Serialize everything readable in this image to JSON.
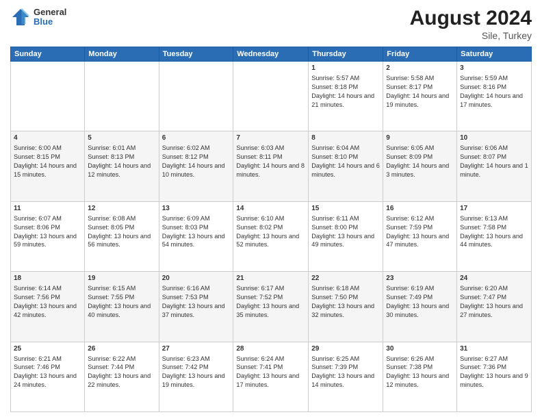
{
  "header": {
    "logo_general": "General",
    "logo_blue": "Blue",
    "month_year": "August 2024",
    "location": "Sile, Turkey"
  },
  "days_of_week": [
    "Sunday",
    "Monday",
    "Tuesday",
    "Wednesday",
    "Thursday",
    "Friday",
    "Saturday"
  ],
  "weeks": [
    [
      {
        "day": "",
        "content": ""
      },
      {
        "day": "",
        "content": ""
      },
      {
        "day": "",
        "content": ""
      },
      {
        "day": "",
        "content": ""
      },
      {
        "day": "1",
        "content": "Sunrise: 5:57 AM\nSunset: 8:18 PM\nDaylight: 14 hours and 21 minutes."
      },
      {
        "day": "2",
        "content": "Sunrise: 5:58 AM\nSunset: 8:17 PM\nDaylight: 14 hours and 19 minutes."
      },
      {
        "day": "3",
        "content": "Sunrise: 5:59 AM\nSunset: 8:16 PM\nDaylight: 14 hours and 17 minutes."
      }
    ],
    [
      {
        "day": "4",
        "content": "Sunrise: 6:00 AM\nSunset: 8:15 PM\nDaylight: 14 hours and 15 minutes."
      },
      {
        "day": "5",
        "content": "Sunrise: 6:01 AM\nSunset: 8:13 PM\nDaylight: 14 hours and 12 minutes."
      },
      {
        "day": "6",
        "content": "Sunrise: 6:02 AM\nSunset: 8:12 PM\nDaylight: 14 hours and 10 minutes."
      },
      {
        "day": "7",
        "content": "Sunrise: 6:03 AM\nSunset: 8:11 PM\nDaylight: 14 hours and 8 minutes."
      },
      {
        "day": "8",
        "content": "Sunrise: 6:04 AM\nSunset: 8:10 PM\nDaylight: 14 hours and 6 minutes."
      },
      {
        "day": "9",
        "content": "Sunrise: 6:05 AM\nSunset: 8:09 PM\nDaylight: 14 hours and 3 minutes."
      },
      {
        "day": "10",
        "content": "Sunrise: 6:06 AM\nSunset: 8:07 PM\nDaylight: 14 hours and 1 minute."
      }
    ],
    [
      {
        "day": "11",
        "content": "Sunrise: 6:07 AM\nSunset: 8:06 PM\nDaylight: 13 hours and 59 minutes."
      },
      {
        "day": "12",
        "content": "Sunrise: 6:08 AM\nSunset: 8:05 PM\nDaylight: 13 hours and 56 minutes."
      },
      {
        "day": "13",
        "content": "Sunrise: 6:09 AM\nSunset: 8:03 PM\nDaylight: 13 hours and 54 minutes."
      },
      {
        "day": "14",
        "content": "Sunrise: 6:10 AM\nSunset: 8:02 PM\nDaylight: 13 hours and 52 minutes."
      },
      {
        "day": "15",
        "content": "Sunrise: 6:11 AM\nSunset: 8:00 PM\nDaylight: 13 hours and 49 minutes."
      },
      {
        "day": "16",
        "content": "Sunrise: 6:12 AM\nSunset: 7:59 PM\nDaylight: 13 hours and 47 minutes."
      },
      {
        "day": "17",
        "content": "Sunrise: 6:13 AM\nSunset: 7:58 PM\nDaylight: 13 hours and 44 minutes."
      }
    ],
    [
      {
        "day": "18",
        "content": "Sunrise: 6:14 AM\nSunset: 7:56 PM\nDaylight: 13 hours and 42 minutes."
      },
      {
        "day": "19",
        "content": "Sunrise: 6:15 AM\nSunset: 7:55 PM\nDaylight: 13 hours and 40 minutes."
      },
      {
        "day": "20",
        "content": "Sunrise: 6:16 AM\nSunset: 7:53 PM\nDaylight: 13 hours and 37 minutes."
      },
      {
        "day": "21",
        "content": "Sunrise: 6:17 AM\nSunset: 7:52 PM\nDaylight: 13 hours and 35 minutes."
      },
      {
        "day": "22",
        "content": "Sunrise: 6:18 AM\nSunset: 7:50 PM\nDaylight: 13 hours and 32 minutes."
      },
      {
        "day": "23",
        "content": "Sunrise: 6:19 AM\nSunset: 7:49 PM\nDaylight: 13 hours and 30 minutes."
      },
      {
        "day": "24",
        "content": "Sunrise: 6:20 AM\nSunset: 7:47 PM\nDaylight: 13 hours and 27 minutes."
      }
    ],
    [
      {
        "day": "25",
        "content": "Sunrise: 6:21 AM\nSunset: 7:46 PM\nDaylight: 13 hours and 24 minutes."
      },
      {
        "day": "26",
        "content": "Sunrise: 6:22 AM\nSunset: 7:44 PM\nDaylight: 13 hours and 22 minutes."
      },
      {
        "day": "27",
        "content": "Sunrise: 6:23 AM\nSunset: 7:42 PM\nDaylight: 13 hours and 19 minutes."
      },
      {
        "day": "28",
        "content": "Sunrise: 6:24 AM\nSunset: 7:41 PM\nDaylight: 13 hours and 17 minutes."
      },
      {
        "day": "29",
        "content": "Sunrise: 6:25 AM\nSunset: 7:39 PM\nDaylight: 13 hours and 14 minutes."
      },
      {
        "day": "30",
        "content": "Sunrise: 6:26 AM\nSunset: 7:38 PM\nDaylight: 13 hours and 12 minutes."
      },
      {
        "day": "31",
        "content": "Sunrise: 6:27 AM\nSunset: 7:36 PM\nDaylight: 13 hours and 9 minutes."
      }
    ]
  ]
}
